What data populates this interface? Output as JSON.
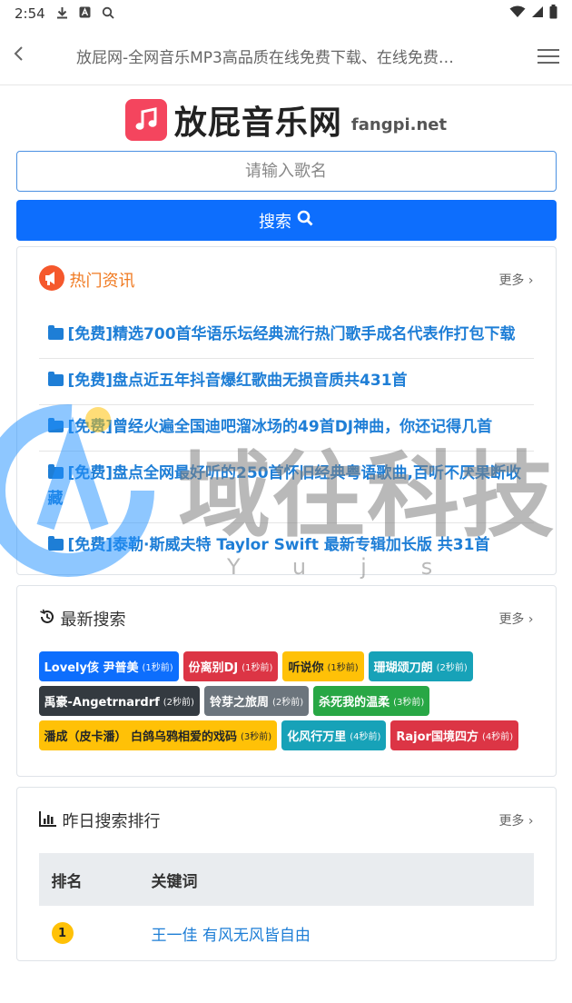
{
  "status": {
    "time": "2:54"
  },
  "browser": {
    "back": "‹",
    "title": "放屁网-全网音乐MP3高品质在线免费下载、在线免费…"
  },
  "brand": {
    "name": "放屁音乐网",
    "domain": "fangpi.net",
    "logo_color": "#f4455e"
  },
  "search": {
    "placeholder": "请输入歌名",
    "button_label": "搜索"
  },
  "news": {
    "title": "热门资讯",
    "more": "更多 ›",
    "items": [
      "[免费]精选700首华语乐坛经典流行热门歌手成名代表作打包下载",
      "[免费]盘点近五年抖音爆红歌曲无损音质共431首",
      "[免费]曾经火遍全国迪吧溜冰场的49首DJ神曲，你还记得几首",
      "[免费]盘点全网最好听的250首怀旧经典粤语歌曲,百听不厌果断收藏",
      "[免费]泰勒·斯威夫特 Taylor Swift 最新专辑加长版 共31首"
    ]
  },
  "latest": {
    "title": "最新搜索",
    "more": "更多 ›",
    "tags": [
      {
        "name": "Lovely侅 尹普美",
        "time": "(1秒前)",
        "color": "#0d6efd"
      },
      {
        "name": "份离别DJ",
        "time": "(1秒前)",
        "color": "#dc3545"
      },
      {
        "name": "听说你",
        "time": "(1秒前)",
        "color": "#ffc107"
      },
      {
        "name": "珊瑚颂刀朗",
        "time": "(2秒前)",
        "color": "#17a2b8"
      },
      {
        "name": "禹豪-Angetrnardrf",
        "time": "(2秒前)",
        "color": "#343a40"
      },
      {
        "name": "铃芽之旅周",
        "time": "(2秒前)",
        "color": "#6c757d"
      },
      {
        "name": "杀死我的温柔",
        "time": "(3秒前)",
        "color": "#28a745"
      },
      {
        "name": "潘成（皮卡潘） 白鸽乌鸦相爱的戏码",
        "time": "(3秒前)",
        "color": "#ffc107"
      },
      {
        "name": "化风行万里",
        "time": "(4秒前)",
        "color": "#17a2b8"
      },
      {
        "name": "Rajor国境四方",
        "time": "(4秒前)",
        "color": "#dc3545"
      }
    ]
  },
  "ranking": {
    "title": "昨日搜索排行",
    "more": "更多 ›",
    "col_rank": "排名",
    "col_keyword": "关键词",
    "rows": [
      {
        "rank": "1",
        "keyword": "王一佳 有风无风皆自由"
      }
    ]
  },
  "watermark": {
    "text": "域往科技",
    "sub": "Yujs"
  }
}
